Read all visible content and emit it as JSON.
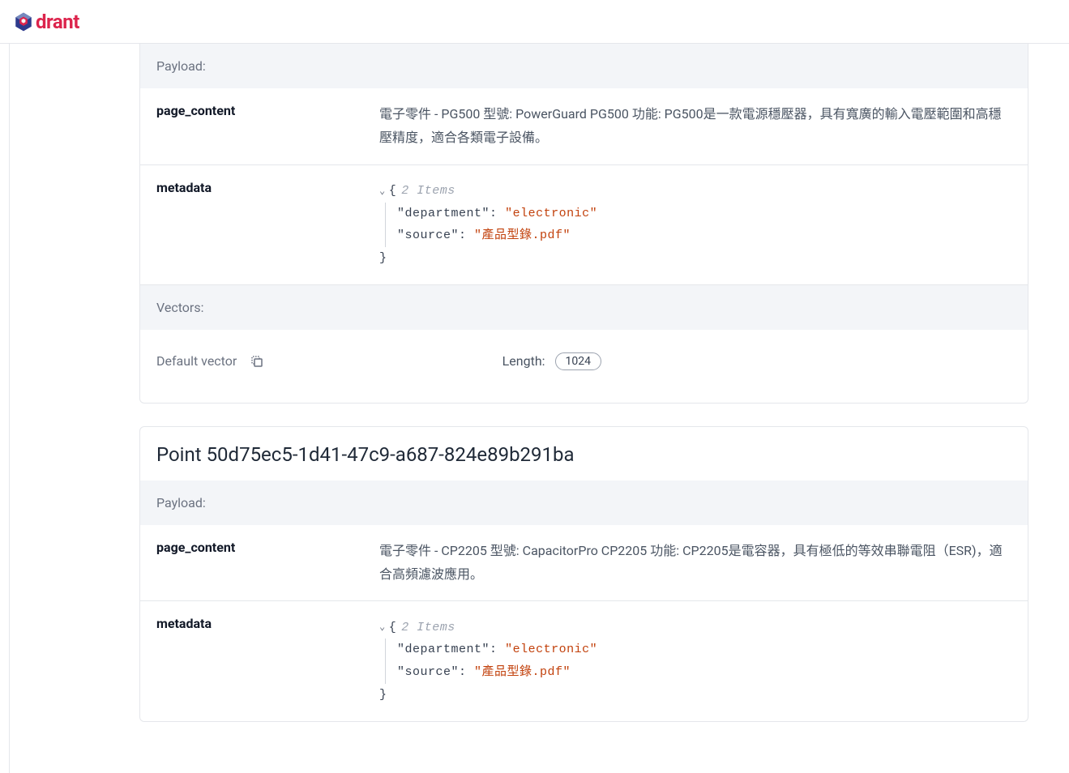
{
  "brand": {
    "name": "drant"
  },
  "labels": {
    "payload": "Payload:",
    "vectors": "Vectors:",
    "default_vector": "Default vector",
    "length": "Length:",
    "items_suffix": "Items"
  },
  "points": [
    {
      "payload": {
        "page_content_key": "page_content",
        "page_content_value": "電子零件 - PG500 型號: PowerGuard PG500 功能: PG500是一款電源穩壓器，具有寬廣的輸入電壓範圍和高穩壓精度，適合各類電子設備。",
        "metadata_key": "metadata",
        "metadata_count": "2",
        "metadata_entries": [
          {
            "k": "\"department\"",
            "v": "\"electronic\""
          },
          {
            "k": "\"source\"",
            "v": "\"產品型錄.pdf\""
          }
        ]
      },
      "vector_length": "1024"
    },
    {
      "title": "Point 50d75ec5-1d41-47c9-a687-824e89b291ba",
      "payload": {
        "page_content_key": "page_content",
        "page_content_value": "電子零件 - CP2205 型號: CapacitorPro CP2205 功能: CP2205是電容器，具有極低的等效串聯電阻（ESR)，適合高頻濾波應用。",
        "metadata_key": "metadata",
        "metadata_count": "2",
        "metadata_entries": [
          {
            "k": "\"department\"",
            "v": "\"electronic\""
          },
          {
            "k": "\"source\"",
            "v": "\"產品型錄.pdf\""
          }
        ]
      }
    }
  ]
}
